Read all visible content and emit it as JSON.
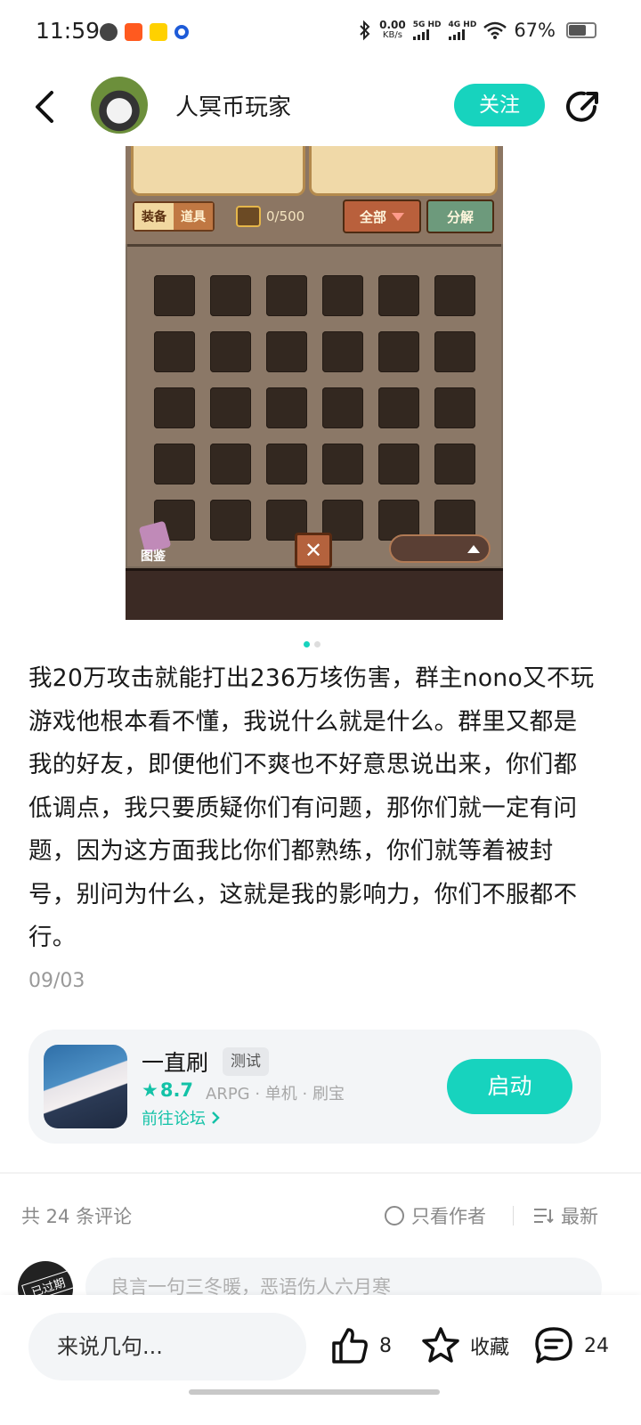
{
  "status_bar": {
    "time": "11:59",
    "speed_value": "0.00",
    "speed_unit": "KB/s",
    "net1": "5G HD",
    "net2": "4G HD",
    "battery": "67%",
    "battery_level": 0.67
  },
  "header": {
    "author_name": "人冥币玩家",
    "follow_label": "关注"
  },
  "game": {
    "tab_equip": "装备",
    "tab_items": "道具",
    "capacity": "0/500",
    "filter_label": "全部",
    "split_label": "分解",
    "codex_label": "图鉴",
    "close_glyph": "✕"
  },
  "carousel": {
    "active_index": 0,
    "count": 2
  },
  "post": {
    "text": "我20万攻击就能打出236万垓伤害，群主nono又不玩游戏他根本看不懂，我说什么就是什么。群里又都是我的好友，即便他们不爽也不好意思说出来，你们都低调点，我只要质疑你们有问题，那你们就一定有问题，因为这方面我比你们都熟练，你们就等着被封号，别问为什么，这就是我的影响力，你们不服都不行。",
    "date": "09/03"
  },
  "app_card": {
    "name": "一直刷",
    "tag": "测试",
    "rating": "8.7",
    "genre": "ARPG · 单机 · 刷宝",
    "forum_link": "前往论坛",
    "start_label": "启动"
  },
  "comments": {
    "count_label": "共 24 条评论",
    "author_only_label": "只看作者",
    "sort_label": "最新",
    "avatar_badge": "已过期",
    "input_placeholder": "良言一句三冬暖，恶语伤人六月寒"
  },
  "bottom_bar": {
    "say_placeholder": "来说几句...",
    "like_count": "8",
    "favorite_label": "收藏",
    "comment_count": "24"
  },
  "colors": {
    "accent": "#17d3be",
    "rating": "#13c2a7"
  }
}
